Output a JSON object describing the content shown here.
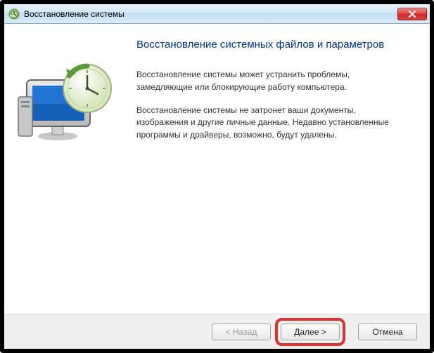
{
  "window": {
    "title": "Восстановление системы"
  },
  "content": {
    "heading": "Восстановление системных файлов и параметров",
    "para1": "Восстановление системы может устранить проблемы, замедляющие или блокирующие работу компьютера.",
    "para2": "Восстановление системы не затронет ваши документы, изображения и другие личные данные. Недавно установленные программы и драйверы, возможно, будут удалены."
  },
  "buttons": {
    "back": "< Назад",
    "next": "Далее >",
    "cancel": "Отмена"
  }
}
